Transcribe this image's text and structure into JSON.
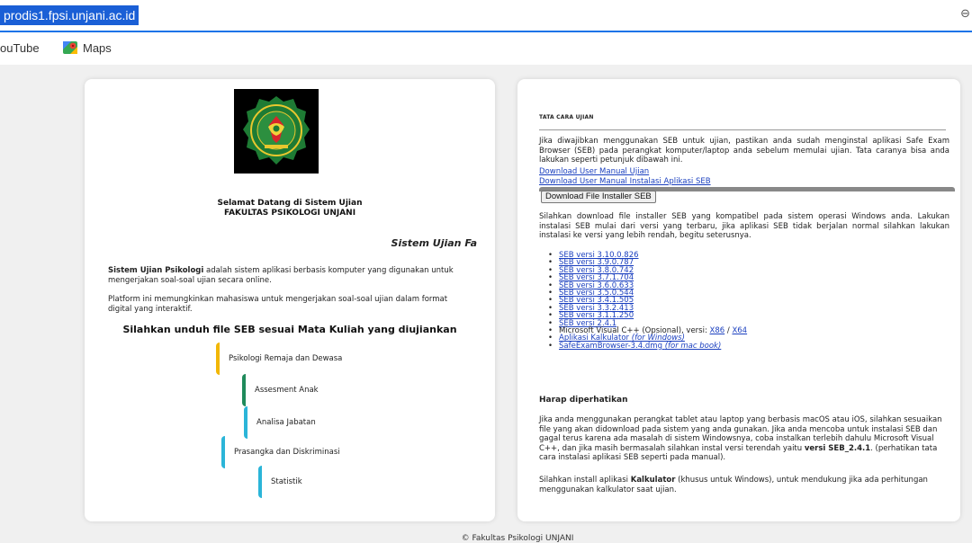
{
  "browser": {
    "url": "prodis1.fpsi.unjani.ac.id",
    "bookmarks": [
      "ouTube",
      "Maps"
    ]
  },
  "left": {
    "welcome_line1": "Selamat Datang di Sistem Ujian",
    "welcome_line2": "FAKULTAS PSIKOLOGI UNJANI",
    "marquee": "Sistem Ujian Fa",
    "desc1_bold": "Sistem Ujian Psikologi",
    "desc1_rest": " adalah sistem aplikasi berbasis komputer yang digunakan untuk mengerjakan soal-soal ujian secara online.",
    "desc2": "Platform ini memungkinkan mahasiswa untuk mengerjakan soal-soal ujian dalam format digital yang interaktif.",
    "seb_heading": "Silahkan unduh file SEB sesuai Mata Kuliah yang diujiankan",
    "courses": [
      {
        "label": "Psikologi Remaja dan Dewasa",
        "color": "#f2b705"
      },
      {
        "label": "Assesment Anak",
        "color": "#1f8a5b"
      },
      {
        "label": "Analisa Jabatan",
        "color": "#2bb5d8"
      },
      {
        "label": "Prasangka dan Diskriminasi",
        "color": "#2bb5d8"
      },
      {
        "label": "Statistik",
        "color": "#2bb5d8"
      }
    ]
  },
  "right": {
    "title": "TATA CARA UJIAN",
    "p1": "Jika diwajibkan menggunakan SEB untuk ujian, pastikan anda sudah menginstal aplikasi Safe Exam Browser (SEB) pada perangkat komputer/laptop anda sebelum memulai ujian. Tata caranya bisa anda lakukan seperti petunjuk dibawah ini.",
    "download_manual": "Download User Manual Ujian",
    "download_manual_seb": "Download User Manual Instalasi Aplikasi SEB",
    "download_button": "Download File Installer SEB",
    "p2": "Silahkan download file installer SEB yang kompatibel pada sistem operasi Windows anda. Lakukan instalasi SEB mulai dari versi yang terbaru, jika aplikasi SEB tidak berjalan normal silahkan lakukan instalasi ke versi yang lebih rendah, begitu seterusnya.",
    "versions": [
      "SEB versi 3.10.0.826",
      "SEB versi 3.9.0.787",
      "SEB versi 3.8.0.742",
      "SEB versi 3.7.1.704",
      "SEB versi 3.6.0.633",
      "SEB versi 3.5.0.544",
      "SEB versi 3.4.1.505",
      "SEB versi 3.3.2.413",
      "SEB versi 3.1.1.250",
      "SEB versi 2.4.1"
    ],
    "vcpp_prefix": "Microsoft Visual C++ (Opsional), versi: ",
    "vcpp_x86": "X86",
    "vcpp_sep": " / ",
    "vcpp_x64": "X64",
    "kalkulator_link": "Aplikasi Kalkulator ",
    "kalkulator_note": "(for Windows)",
    "mac_link": "SafeExamBrowser-3.4.dmg ",
    "mac_note": "(for mac book)",
    "harap": "Harap diperhatikan",
    "p3_part1": "Jika anda menggunakan perangkat tablet atau laptop yang berbasis macOS atau iOS, silahkan sesuaikan file yang akan didownload pada sistem yang anda gunakan. Jika anda mencoba untuk instalasi SEB dan gagal terus karena ada masalah di sistem Windowsnya, coba instalkan terlebih dahulu Microsoft Visual C++, dan jika masih bermasalah silahkan instal versi terendah yaitu ",
    "p3_bold": "versi SEB_2.4.1",
    "p3_part2": ". (perhatikan tata cara instalasi aplikasi SEB seperti pada manual).",
    "p4_part1": "Silahkan install aplikasi ",
    "p4_bold": "Kalkulator",
    "p4_part2": " (khusus untuk Windows), untuk mendukung jika ada perhitungan menggunakan kalkulator saat ujian."
  },
  "footer": "© Fakultas Psikologi UNJANI"
}
